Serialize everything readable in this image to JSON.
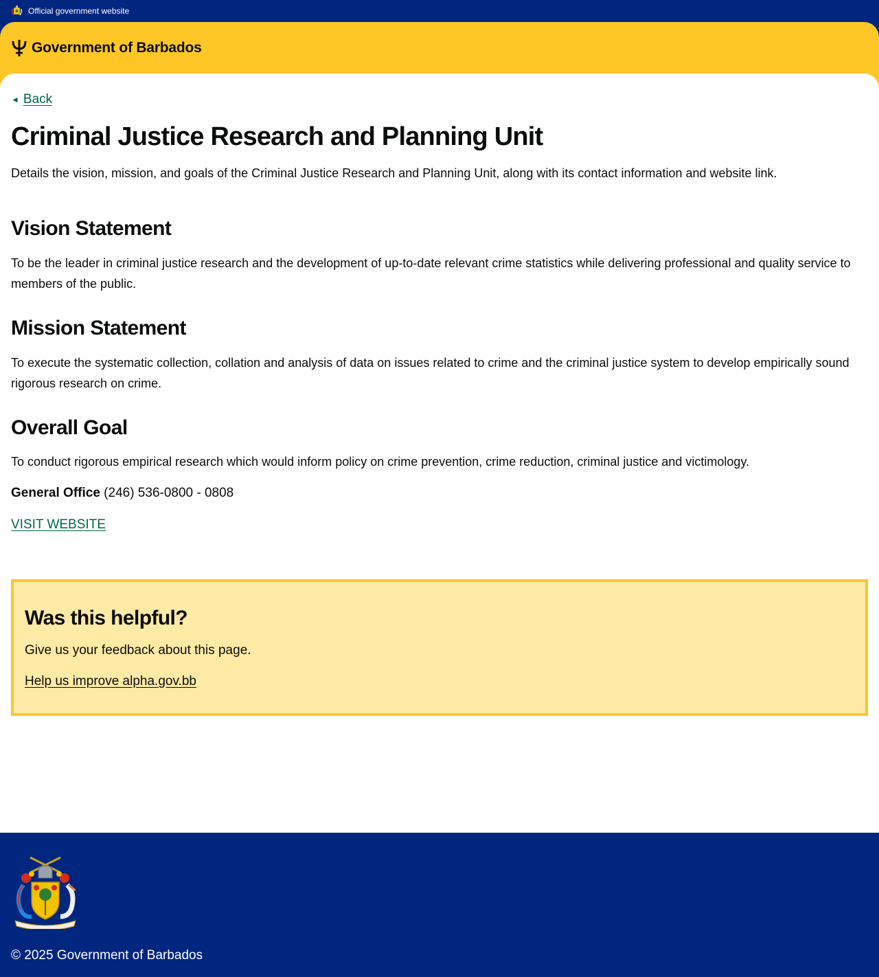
{
  "banner": {
    "text": "Official government website",
    "crest_icon": "coat-of-arms-icon"
  },
  "header": {
    "brand_name": "Government of Barbados",
    "logo_icon": "trident-icon",
    "background": "#ffc726"
  },
  "nav": {
    "back_label": "Back",
    "back_icon": "arrow-left-icon"
  },
  "page": {
    "title": "Criminal Justice Research and Planning Unit",
    "summary": "Details the vision, mission, and goals of the Criminal Justice Research and Planning Unit, along with its contact information and website link."
  },
  "sections": [
    {
      "heading": "Vision Statement",
      "body": "To be the leader in criminal justice research and the development of up-to-date relevant crime statistics while delivering professional and quality service to members of the public."
    },
    {
      "heading": "Mission Statement",
      "body": "To execute the systematic collection, collation and analysis of data on issues related to crime and the criminal justice system to develop empirically sound rigorous research on crime."
    },
    {
      "heading": "Overall Goal",
      "body": "To conduct rigorous empirical research which would inform policy on crime prevention, crime reduction, criminal justice and victimology."
    }
  ],
  "contact": {
    "label": "General Office",
    "phone": "(246) 536-0800 - 0808"
  },
  "website_link": "VISIT WEBSITE",
  "feedback": {
    "title": "Was this helpful?",
    "text": "Give us your feedback about this page.",
    "link": "Help us improve alpha.gov.bb"
  },
  "footer": {
    "copyright": "© 2025 Government of Barbados"
  },
  "colors": {
    "navy": "#00267f",
    "gold": "#ffc726",
    "link_green": "#00654a",
    "feedback_bg": "#ffeaa6"
  }
}
